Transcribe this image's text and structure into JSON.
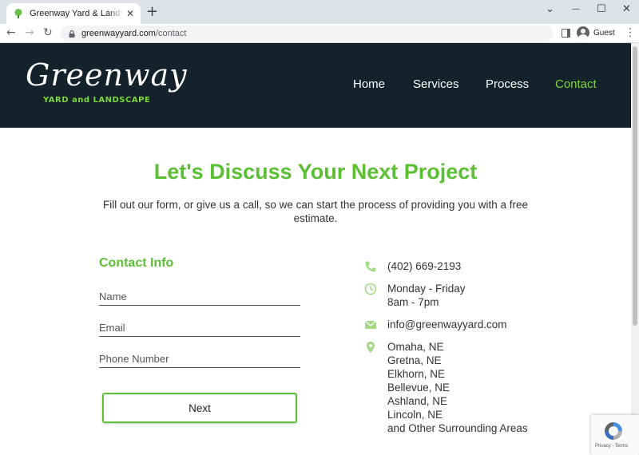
{
  "browser": {
    "tab_title": "Greenway Yard & Landscape - Gr",
    "tab_close": "✕",
    "new_tab": "+",
    "url_domain": "greenwayyard.com",
    "url_path": "/contact",
    "profile_label": "Guest",
    "minimize": "⌄",
    "restore": "—",
    "maximize": "☐",
    "close": "✕",
    "back": "←",
    "forward": "→",
    "reload": "↻",
    "menu": "⋮"
  },
  "site": {
    "logo_script": "Greenway",
    "logo_sub": "YARD and LANDSCAPE",
    "nav": [
      {
        "label": "Home",
        "active": false
      },
      {
        "label": "Services",
        "active": false
      },
      {
        "label": "Process",
        "active": false
      },
      {
        "label": "Contact",
        "active": true
      }
    ]
  },
  "main": {
    "headline": "Let's Discuss Your Next Project",
    "intro": "Fill out our form, or give us a call, so we can start the process of providing you with a free estimate.",
    "form": {
      "title": "Contact Info",
      "name_placeholder": "Name",
      "email_placeholder": "Email",
      "phone_placeholder": "Phone Number",
      "submit_label": "Next"
    },
    "contact": {
      "phone": "(402) 669-2193",
      "hours_days": "Monday - Friday",
      "hours_time": "8am - 7pm",
      "email": "info@greenwayyard.com",
      "locations": [
        "Omaha, NE",
        "Gretna, NE",
        "Elkhorn, NE",
        "Bellevue, NE",
        "Ashland, NE",
        "Lincoln, NE",
        "and Other Surrounding Areas"
      ]
    },
    "recaptcha_text": "Privacy - Terms"
  },
  "colors": {
    "accent": "#5cbf33",
    "nav_active": "#7bd63c",
    "header_bg": "#13222b",
    "icon_green": "#a5d98a"
  }
}
